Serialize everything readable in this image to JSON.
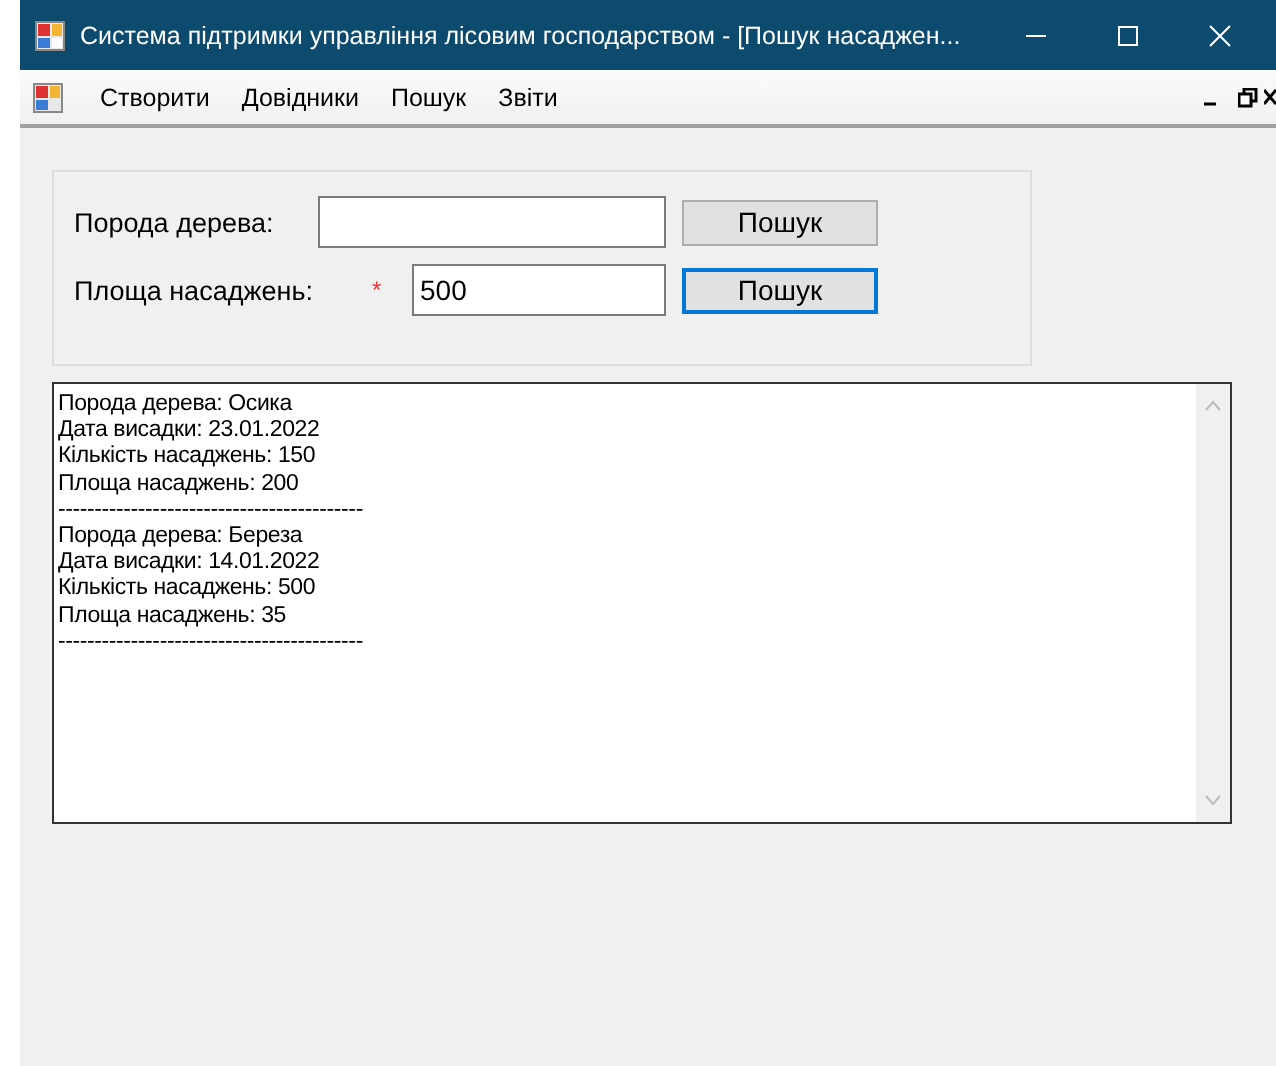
{
  "window": {
    "title": "Система підтримки управління лісовим господарством - [Пошук насаджен..."
  },
  "menu": [
    "Створити",
    "Довідники",
    "Пошук",
    "Звіти"
  ],
  "search_rows": [
    {
      "label": "Порода дерева:",
      "required": false,
      "value": "",
      "button": "Пошук",
      "focused": false
    },
    {
      "label": "Площа насаджень:",
      "required": true,
      "value": "500",
      "button": "Пошук",
      "focused": true
    }
  ],
  "required_mark": "*",
  "results": {
    "lines": [
      "Порода дерева: Осика",
      "Дата висадки: 23.01.2022",
      "Кількість насаджень: 150",
      "Площа насаджень: 200",
      "------------------------------------------",
      "Порода дерева: Береза",
      "Дата висадки: 14.01.2022",
      "Кількість насаджень: 500",
      "Площа насаджень: 35",
      "------------------------------------------"
    ]
  }
}
